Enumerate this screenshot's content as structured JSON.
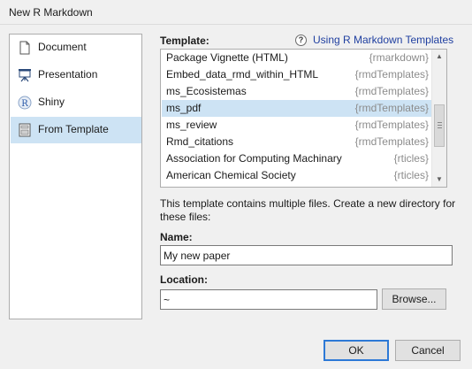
{
  "window": {
    "title": "New R Markdown"
  },
  "sidebar": {
    "items": [
      {
        "label": "Document",
        "icon": "document-icon"
      },
      {
        "label": "Presentation",
        "icon": "presentation-icon"
      },
      {
        "label": "Shiny",
        "icon": "shiny-r-icon"
      },
      {
        "label": "From Template",
        "icon": "template-icon",
        "selected": true
      }
    ]
  },
  "template": {
    "label": "Template:",
    "help_link": "Using R Markdown Templates",
    "items": [
      {
        "name": "Package Vignette (HTML)",
        "package": "{rmarkdown}"
      },
      {
        "name": "Embed_data_rmd_within_HTML",
        "package": "{rmdTemplates}"
      },
      {
        "name": "ms_Ecosistemas",
        "package": "{rmdTemplates}"
      },
      {
        "name": "ms_pdf",
        "package": "{rmdTemplates}",
        "selected": true
      },
      {
        "name": "ms_review",
        "package": "{rmdTemplates}"
      },
      {
        "name": "Rmd_citations",
        "package": "{rmdTemplates}"
      },
      {
        "name": "Association for Computing Machinary",
        "package": "{rticles}"
      },
      {
        "name": "American Chemical Society",
        "package": "{rticles}"
      }
    ],
    "description": "This template contains multiple files. Create a new directory for these files:"
  },
  "name_field": {
    "label": "Name:",
    "value": "My new paper"
  },
  "location_field": {
    "label": "Location:",
    "value": "~"
  },
  "buttons": {
    "browse": "Browse...",
    "ok": "OK",
    "cancel": "Cancel"
  },
  "colors": {
    "selection": "#cde3f4",
    "link": "#1f3fa0",
    "default_button_border": "#2d79d6"
  }
}
